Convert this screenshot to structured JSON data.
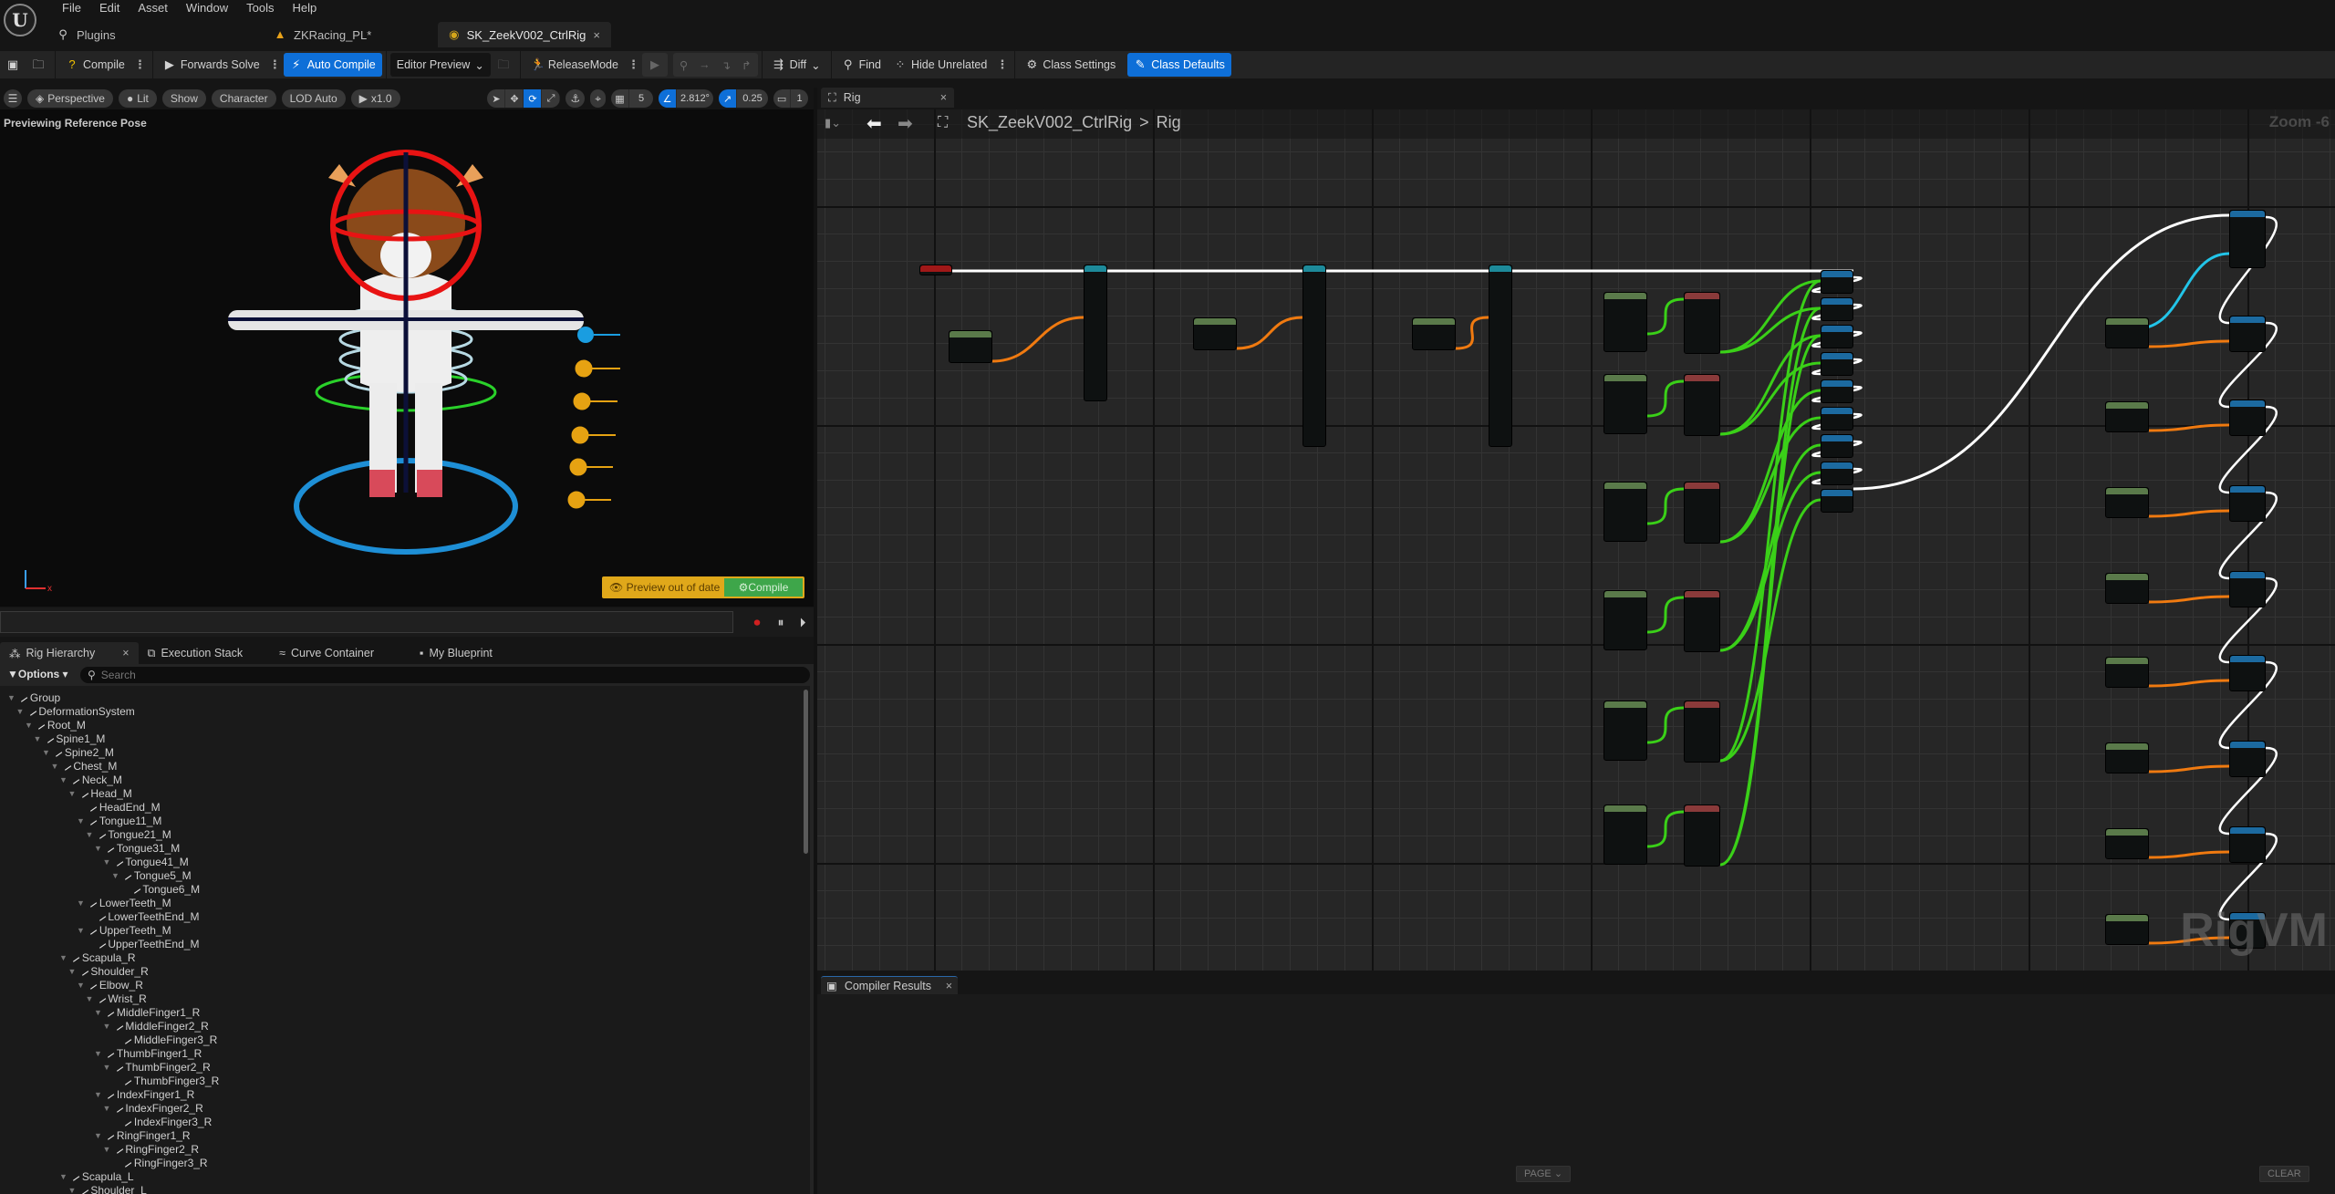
{
  "app": {
    "menu": [
      "File",
      "Edit",
      "Asset",
      "Window",
      "Tools",
      "Help"
    ],
    "doc_tabs": [
      {
        "label": "Plugins",
        "icon": "plug-icon",
        "active": false
      },
      {
        "label": "ZKRacing_PL*",
        "icon": "level-icon",
        "active": false
      },
      {
        "label": "SK_ZeekV002_CtrlRig",
        "icon": "control-rig-icon",
        "active": true
      }
    ]
  },
  "toolbar": {
    "save_icon": "save-icon",
    "browse_icon": "browse-icon",
    "compile": "Compile",
    "forwards_solve": "Forwards Solve",
    "auto_compile": "Auto Compile",
    "editor_preview": "Editor Preview",
    "release_mode": "ReleaseMode",
    "diff": "Diff",
    "find": "Find",
    "hide_unrelated": "Hide Unrelated",
    "class_settings": "Class Settings",
    "class_defaults": "Class Defaults"
  },
  "viewport": {
    "perspective": "Perspective",
    "lit": "Lit",
    "show": "Show",
    "character": "Character",
    "lod": "LOD Auto",
    "speed": "x1.0",
    "grid_snap": "5",
    "rotation_snap": "2.812°",
    "scale_snap": "0.25",
    "camera_speed": "1",
    "preview_label": "Previewing Reference Pose",
    "banner_text": "Preview out of date",
    "banner_compile": "Compile",
    "colors": {
      "banner": "#e0a81a",
      "compile": "#3ea64a",
      "accent": "#0e6fd8"
    }
  },
  "bottom_tabs": [
    {
      "label": "Rig Hierarchy",
      "active": true
    },
    {
      "label": "Execution Stack",
      "active": false
    },
    {
      "label": "Curve Container",
      "active": false
    },
    {
      "label": "My Blueprint",
      "active": false
    }
  ],
  "hierarchy": {
    "options": "Options",
    "search_placeholder": "Search",
    "nodes": [
      {
        "label": "Group",
        "depth": 0,
        "expanded": true
      },
      {
        "label": "DeformationSystem",
        "depth": 1,
        "expanded": true
      },
      {
        "label": "Root_M",
        "depth": 2,
        "expanded": true
      },
      {
        "label": "Spine1_M",
        "depth": 3,
        "expanded": true
      },
      {
        "label": "Spine2_M",
        "depth": 4,
        "expanded": true
      },
      {
        "label": "Chest_M",
        "depth": 5,
        "expanded": true
      },
      {
        "label": "Neck_M",
        "depth": 6,
        "expanded": true
      },
      {
        "label": "Head_M",
        "depth": 7,
        "expanded": true
      },
      {
        "label": "HeadEnd_M",
        "depth": 8,
        "expanded": false
      },
      {
        "label": "Tongue11_M",
        "depth": 8,
        "expanded": true
      },
      {
        "label": "Tongue21_M",
        "depth": 9,
        "expanded": true
      },
      {
        "label": "Tongue31_M",
        "depth": 10,
        "expanded": true
      },
      {
        "label": "Tongue41_M",
        "depth": 11,
        "expanded": true
      },
      {
        "label": "Tongue5_M",
        "depth": 12,
        "expanded": true
      },
      {
        "label": "Tongue6_M",
        "depth": 13,
        "expanded": false
      },
      {
        "label": "LowerTeeth_M",
        "depth": 8,
        "expanded": true
      },
      {
        "label": "LowerTeethEnd_M",
        "depth": 9,
        "expanded": false
      },
      {
        "label": "UpperTeeth_M",
        "depth": 8,
        "expanded": true
      },
      {
        "label": "UpperTeethEnd_M",
        "depth": 9,
        "expanded": false
      },
      {
        "label": "Scapula_R",
        "depth": 6,
        "expanded": true
      },
      {
        "label": "Shoulder_R",
        "depth": 7,
        "expanded": true
      },
      {
        "label": "Elbow_R",
        "depth": 8,
        "expanded": true
      },
      {
        "label": "Wrist_R",
        "depth": 9,
        "expanded": true
      },
      {
        "label": "MiddleFinger1_R",
        "depth": 10,
        "expanded": true
      },
      {
        "label": "MiddleFinger2_R",
        "depth": 11,
        "expanded": true
      },
      {
        "label": "MiddleFinger3_R",
        "depth": 12,
        "expanded": false
      },
      {
        "label": "ThumbFinger1_R",
        "depth": 10,
        "expanded": true
      },
      {
        "label": "ThumbFinger2_R",
        "depth": 11,
        "expanded": true
      },
      {
        "label": "ThumbFinger3_R",
        "depth": 12,
        "expanded": false
      },
      {
        "label": "IndexFinger1_R",
        "depth": 10,
        "expanded": true
      },
      {
        "label": "IndexFinger2_R",
        "depth": 11,
        "expanded": true
      },
      {
        "label": "IndexFinger3_R",
        "depth": 12,
        "expanded": false
      },
      {
        "label": "RingFinger1_R",
        "depth": 10,
        "expanded": true
      },
      {
        "label": "RingFinger2_R",
        "depth": 11,
        "expanded": true
      },
      {
        "label": "RingFinger3_R",
        "depth": 12,
        "expanded": false
      },
      {
        "label": "Scapula_L",
        "depth": 6,
        "expanded": true
      },
      {
        "label": "Shoulder_L",
        "depth": 7,
        "expanded": true
      }
    ]
  },
  "graph": {
    "tab": "Rig",
    "breadcrumb_root": "SK_ZeekV002_CtrlRig",
    "breadcrumb_sep": ">",
    "breadcrumb_leaf": "Rig",
    "zoom": "Zoom -6",
    "watermark": "RigVM"
  },
  "compiler": {
    "tab": "Compiler Results",
    "page": "PAGE",
    "clear": "CLEAR"
  }
}
